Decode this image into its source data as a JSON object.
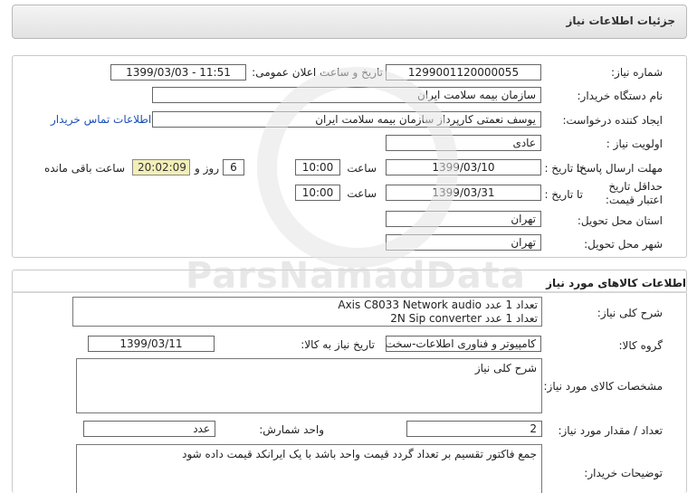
{
  "header": {
    "title": "جزئیات اطلاعات نیاز"
  },
  "need_info": {
    "need_number_label": "شماره نیاز:",
    "need_number": "1299001120000055",
    "announce_label": "تاریخ و ساعت اعلان عمومی:",
    "announce_value": "1399/03/03 - 11:51",
    "buyer_org_label": "نام دستگاه خریدار:",
    "buyer_org": "سازمان بیمه سلامت ایران",
    "creator_label": "ایجاد کننده درخواست:",
    "creator": "یوسف نعمتی کارپرداز سازمان بیمه سلامت ایران",
    "contact_link": "اطلاعات تماس خریدار",
    "priority_label": "اولویت نیاز :",
    "priority": "عادی",
    "deadline_label": "مهلت ارسال پاسخ:",
    "deadline_to": "تا تاریخ :",
    "deadline_date": "1399/03/10",
    "time_label": "ساعت",
    "deadline_time": "10:00",
    "days_value": "6",
    "days_label": "روز و",
    "remaining_time": "20:02:09",
    "remaining_label": "ساعت باقی مانده",
    "validity_label": "حداقل تاریخ اعتبار قیمت:",
    "validity_to": "تا تاریخ :",
    "validity_date": "1399/03/31",
    "validity_time_label": "ساعت",
    "validity_time": "10:00",
    "province_label": "استان محل تحویل:",
    "province": "تهران",
    "city_label": "شهر محل تحویل:",
    "city": "تهران"
  },
  "goods": {
    "section_title": "اطلاعات کالاهای مورد نیاز",
    "summary_label": "شرح کلی نیاز:",
    "summary_line1": "Axis C8033 Network audio تعداد 1 عدد",
    "summary_line2": "2N Sip converter تعداد 1 عدد",
    "group_label": "گروه کالا:",
    "group": "کامپیوتر و فناوری اطلاعات-سخت افزار",
    "need_date_label": "تاریخ نیاز به کالا:",
    "need_date": "1399/03/11",
    "specs_label": "مشخصات کالای مورد نیاز:",
    "specs": "شرح کلی نیاز",
    "qty_label": "تعداد / مقدار مورد نیاز:",
    "qty": "2",
    "unit_label": "واحد شمارش:",
    "unit": "عدد",
    "buyer_notes_label": "توضیحات خریدار:",
    "buyer_notes": "جمع فاکتور تقسیم بر تعداد گردد قیمت واحد باشد با یک ایرانکد قیمت داده شود"
  },
  "watermark": {
    "brand": "ParsNamadData"
  }
}
